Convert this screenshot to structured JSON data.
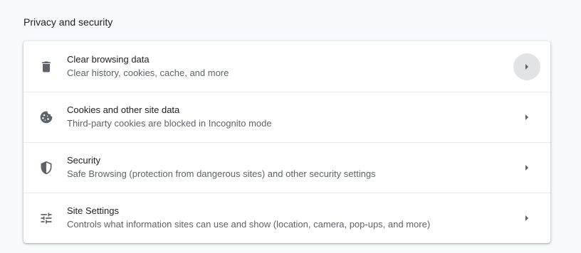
{
  "section": {
    "title": "Privacy and security"
  },
  "rows": [
    {
      "icon": "trash-icon",
      "label": "Clear browsing data",
      "sublabel": "Clear history, cookies, cache, and more",
      "hovered": true
    },
    {
      "icon": "cookie-icon",
      "label": "Cookies and other site data",
      "sublabel": "Third-party cookies are blocked in Incognito mode",
      "hovered": false
    },
    {
      "icon": "shield-icon",
      "label": "Security",
      "sublabel": "Safe Browsing (protection from dangerous sites) and other security settings",
      "hovered": false
    },
    {
      "icon": "tune-sliders-icon",
      "label": "Site Settings",
      "sublabel": "Controls what information sites can use and show (location, camera, pop-ups, and more)",
      "hovered": false
    }
  ],
  "colors": {
    "page_background": "#f8f9fa",
    "card_background": "#ffffff",
    "primary_text": "#202124",
    "secondary_text": "#5f6368",
    "hover_circle": "#e2e3e5"
  }
}
